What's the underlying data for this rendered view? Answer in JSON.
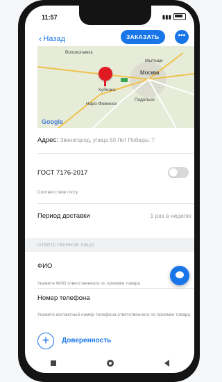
{
  "status": {
    "time": "11:57"
  },
  "header": {
    "back_label": "Назад",
    "order_label": "ЗАКАЗАТЬ",
    "more_label": "•••"
  },
  "map": {
    "labels": [
      "Волоколамск",
      "Мытищи",
      "Москва",
      "Кубинка",
      "Наро-Фоминск",
      "Подольск"
    ],
    "provider": "Google"
  },
  "address": {
    "label": "Адрес:",
    "value": "Звенигород, улица 50 Лет Победы, 7"
  },
  "gost": {
    "label": "ГОСТ 7176-2017",
    "hint": "Соответствие госту"
  },
  "delivery": {
    "label": "Период доставки",
    "value": "1 раз в неделю"
  },
  "section_title": "ОТВЕТСТВЕННОЕ ЛИЦО",
  "fio": {
    "label": "ФИО",
    "hint": "Укажите ФИО ответственного по приемке товара"
  },
  "phone": {
    "label": "Номер телефона",
    "hint": "Укажите контактный номер телефона ответственного по приемке товара"
  },
  "dov_label": "Доверенность",
  "colors": {
    "accent": "#1976e8",
    "pin": "#e01b24"
  }
}
